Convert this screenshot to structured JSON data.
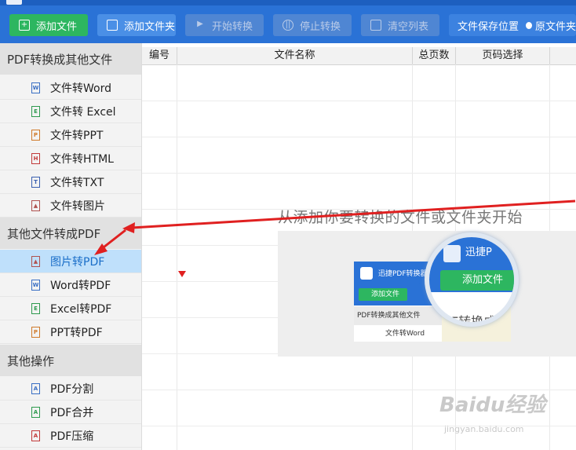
{
  "toolbar": {
    "add_file": "添加文件",
    "add_folder": "添加文件夹",
    "start": "开始转换",
    "stop": "停止转换",
    "clear": "清空列表",
    "save_location": "文件保存位置",
    "radio_original": "原文件夹"
  },
  "sidebar": {
    "section1": "PDF转换成其他文件",
    "section1_items": [
      "文件转Word",
      "文件转 Excel",
      "文件转PPT",
      "文件转HTML",
      "文件转TXT",
      "文件转图片"
    ],
    "section2": "其他文件转成PDF",
    "section2_items": [
      "图片转PDF",
      "Word转PDF",
      "Excel转PDF",
      "PPT转PDF"
    ],
    "section3": "其他操作",
    "section3_items": [
      "PDF分割",
      "PDF合并",
      "PDF压缩"
    ],
    "active_item": "图片转PDF"
  },
  "table": {
    "columns": [
      "编号",
      "文件名称",
      "总页数",
      "页码选择"
    ]
  },
  "hint": {
    "text": "从添加你要转换的文件或文件夹开始",
    "mini_title": "迅捷PDF转换器",
    "mini_add": "添加文件",
    "mini_section": "PDF转换成其他文件",
    "mini_item": "文件转Word",
    "mag_title": "迅捷P",
    "mag_add": "添加文件",
    "mag_sub": "PDF转换成其"
  },
  "watermark": {
    "brand": "Baidu经验",
    "url": "jingyan.baidu.com"
  },
  "colors": {
    "toolbar": "#2a72d6",
    "green": "#2db660",
    "active_bg": "#bfe0fb",
    "arrow": "#e02020"
  }
}
